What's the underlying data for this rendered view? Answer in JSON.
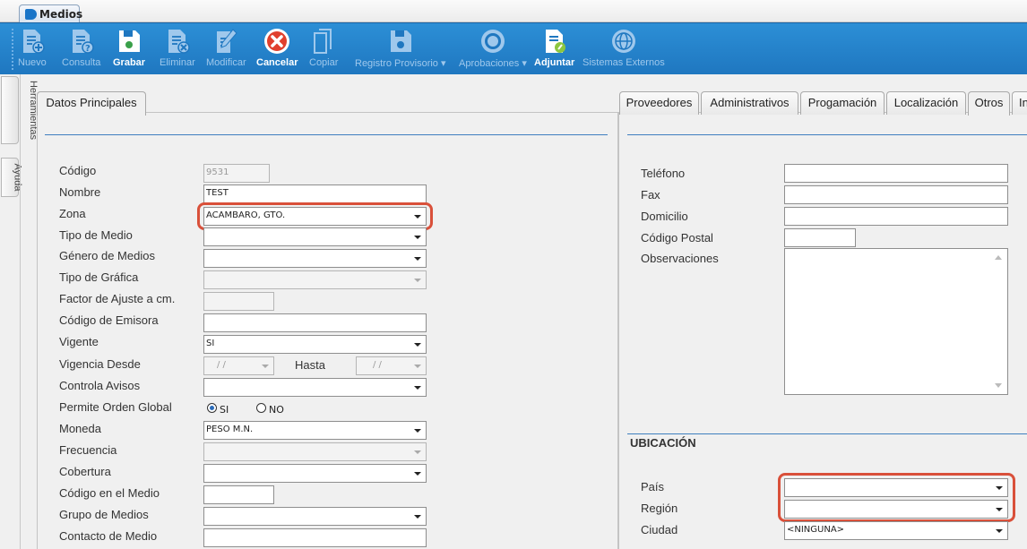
{
  "document_tab": {
    "label": "Medios"
  },
  "ribbon": {
    "nuevo": "Nuevo",
    "consulta": "Consulta",
    "grabar": "Grabar",
    "eliminar": "Eliminar",
    "modificar": "Modificar",
    "cancelar": "Cancelar",
    "copiar": "Copiar",
    "registro_provisorio": "Registro Provisorio ▾",
    "aprobaciones": "Aprobaciones ▾",
    "adjuntar": "Adjuntar",
    "sistemas_externos": "Sistemas Externos"
  },
  "side_tabs": {
    "herramientas": "Herramientas",
    "ayuda": "Ayuda"
  },
  "left_panel": {
    "tab": "Datos Principales",
    "labels": {
      "codigo": "Código",
      "nombre": "Nombre",
      "zona": "Zona",
      "tipo_medio": "Tipo de Medio",
      "genero_medios": "Género de Medios",
      "tipo_grafica": "Tipo de Gráfica",
      "factor_ajuste": "Factor de Ajuste a cm.",
      "codigo_emisora": "Código de Emisora",
      "vigente": "Vigente",
      "vigencia_desde": "Vigencia Desde",
      "hasta": "Hasta",
      "controla_avisos": "Controla Avisos",
      "permite_orden": "Permite Orden Global",
      "moneda": "Moneda",
      "frecuencia": "Frecuencia",
      "cobertura": "Cobertura",
      "codigo_medio": "Código en el Medio",
      "grupo_medios": "Grupo de Medios",
      "contacto_medio": "Contacto de Medio"
    },
    "values": {
      "codigo": "9531",
      "nombre": "TEST",
      "zona": "ACAMBARO, GTO.",
      "vigente": "SI",
      "vigencia_desde": "/ /",
      "hasta": "/ /",
      "moneda": "PESO M.N."
    },
    "radio": {
      "si": "SI",
      "no": "NO",
      "selected": "SI"
    }
  },
  "right_panel": {
    "tabs": [
      "Proveedores",
      "Administrativos",
      "Progamación",
      "Localización",
      "Otros",
      "In"
    ],
    "active_tab": "Otros",
    "labels": {
      "telefono": "Teléfono",
      "fax": "Fax",
      "domicilio": "Domicilio",
      "codigo_postal": "Código Postal",
      "observaciones": "Observaciones",
      "pais": "País",
      "region": "Región",
      "ciudad": "Ciudad"
    },
    "section_ubicacion": "UBICACIÓN",
    "values": {
      "ciudad": "<NINGUNA>"
    }
  },
  "colors": {
    "ribbon": "#1f77c0",
    "highlight": "#d9503a",
    "section_line": "#3f7fbf"
  }
}
